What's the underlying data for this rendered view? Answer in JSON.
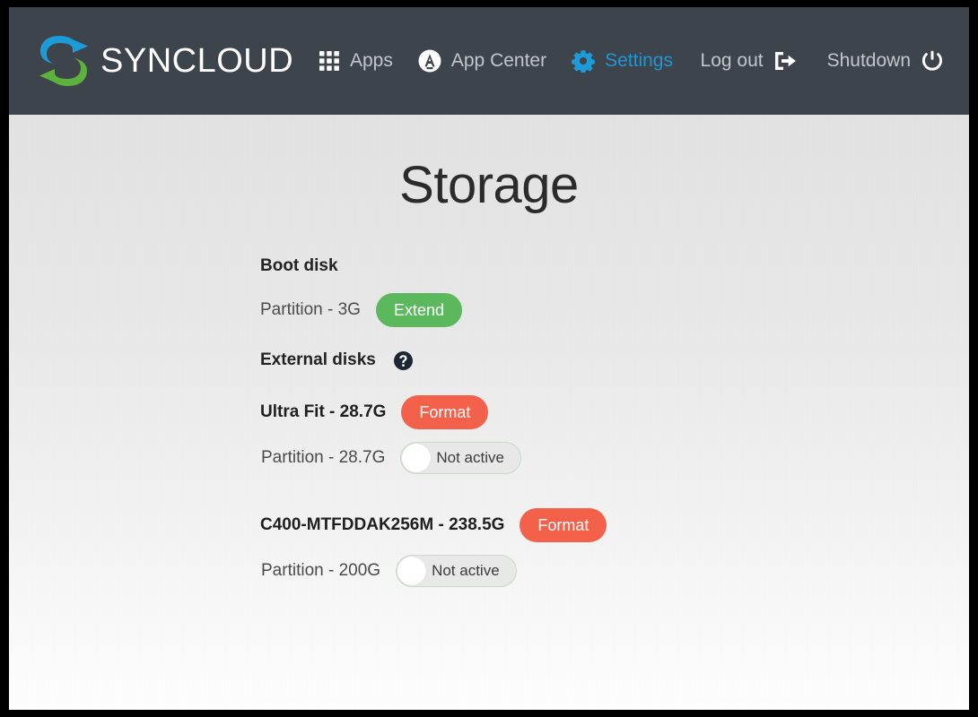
{
  "navbar": {
    "brand": {
      "name": "SYNCLOUD",
      "logo_icon": "syncloud-logo-icon"
    },
    "left_items": [
      {
        "label": "Apps",
        "icon": "apps-grid-icon",
        "active": false
      },
      {
        "label": "App Center",
        "icon": "app-center-icon",
        "active": false
      },
      {
        "label": "Settings",
        "icon": "gear-icon",
        "active": true
      }
    ],
    "right_items": [
      {
        "label": "Log out",
        "icon": "sign-out-icon"
      },
      {
        "label": "Shutdown",
        "icon": "power-icon"
      }
    ]
  },
  "page": {
    "title": "Storage"
  },
  "storage": {
    "boot_disk": {
      "heading": "Boot disk",
      "partition_label": "Partition - 3G",
      "extend_label": "Extend"
    },
    "external_disks": {
      "heading": "External disks",
      "help_icon": "question-mark-circle-icon",
      "disks": [
        {
          "title": "Ultra Fit - 28.7G",
          "format_label": "Format",
          "partition_label": "Partition - 28.7G",
          "toggle_label": "Not active",
          "toggle_on": false
        },
        {
          "title": "C400-MTFDDAK256M - 238.5G",
          "format_label": "Format",
          "partition_label": "Partition - 200G",
          "toggle_label": "Not active",
          "toggle_on": false
        }
      ]
    }
  },
  "colors": {
    "navbar_bg": "#3e444c",
    "accent_blue": "#2196d4",
    "success_green": "#5cb85c",
    "danger_red": "#f4614a",
    "logo_blue": "#1b9bd8",
    "logo_green": "#5cb23c",
    "content_bg_top": "#e3e3e3",
    "content_bg_bottom": "#ffffff"
  }
}
